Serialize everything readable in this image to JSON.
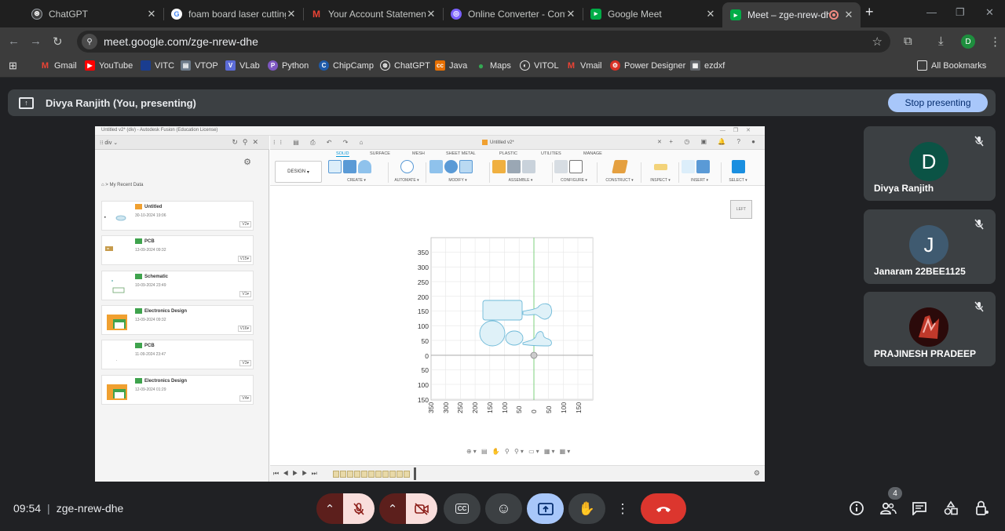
{
  "browser": {
    "tabs": [
      {
        "title": "ChatGPT",
        "favicon": "chatgpt-icon",
        "color": "#e8eaed"
      },
      {
        "title": "foam board laser cutting o",
        "favicon": "google-icon",
        "color": "#4285f4"
      },
      {
        "title": "Your Account Statement fo",
        "favicon": "gmail-icon",
        "color": "#ea4335"
      },
      {
        "title": "Online Converter - Convert",
        "favicon": "converter-icon",
        "color": "#7b61ff"
      },
      {
        "title": "Google Meet",
        "favicon": "meet-icon",
        "color": "#00ac47"
      },
      {
        "title": "Meet – zge-nrew-dhe",
        "favicon": "meet-icon",
        "color": "#00ac47",
        "active": true
      }
    ],
    "new_tab": "+",
    "url": "meet.google.com/zge-nrew-dhe",
    "profile_initial": "D",
    "bookmarks": [
      {
        "label": "Gmail",
        "icon": "gmail-icon",
        "color": "#ea4335"
      },
      {
        "label": "YouTube",
        "icon": "youtube-icon",
        "color": "#ff0000"
      },
      {
        "label": "VITC",
        "icon": "vitc-icon",
        "color": "#1a3d8f"
      },
      {
        "label": "VTOP",
        "icon": "vtop-icon",
        "color": "#6c7a89"
      },
      {
        "label": "VLab",
        "icon": "vlab-icon",
        "color": "#5b6bd6"
      },
      {
        "label": "Python",
        "icon": "python-icon",
        "color": "#7e57c2"
      },
      {
        "label": "ChipCamp",
        "icon": "chipcamp-icon",
        "color": "#1e5aa8"
      },
      {
        "label": "ChatGPT",
        "icon": "chatgpt-icon",
        "color": "#202124"
      },
      {
        "label": "Java",
        "icon": "java-icon",
        "color": "#e76f00"
      },
      {
        "label": "Maps",
        "icon": "maps-icon",
        "color": "#34a853"
      },
      {
        "label": "VITOL",
        "icon": "vitol-icon",
        "color": "#5f6368"
      },
      {
        "label": "Vmail",
        "icon": "vmail-icon",
        "color": "#ea4335"
      },
      {
        "label": "Power Designer",
        "icon": "power-designer-icon",
        "color": "#d93025"
      },
      {
        "label": "ezdxf",
        "icon": "ezdxf-icon",
        "color": "#9aa0a6"
      }
    ],
    "all_bookmarks": "All Bookmarks"
  },
  "meet": {
    "presenter_text": "Divya Ranjith (You, presenting)",
    "stop_presenting": "Stop presenting",
    "participants": [
      {
        "name": "Divya Ranjith",
        "initial": "D",
        "avatar_color": "#0b5345"
      },
      {
        "name": "Janaram 22BEE1125",
        "initial": "J",
        "avatar_color": "#3f5a70"
      },
      {
        "name": "PRAJINESH PRADEEP",
        "initial": "",
        "avatar_color": "#2b0a0a"
      }
    ],
    "time": "09:54",
    "meeting_code": "zge-nrew-dhe",
    "participant_count": "4"
  },
  "fusion": {
    "window_title": "Untitled v2* (div) - Autodesk Fusion (Education License)",
    "team": "div",
    "breadcrumb": "My Recent Data",
    "doc_tab": "Untitled v2*",
    "design_button": "DESIGN",
    "ribbon_tabs": [
      "SOLID",
      "SURFACE",
      "MESH",
      "SHEET METAL",
      "PLASTIC",
      "UTILITIES",
      "MANAGE"
    ],
    "ribbon_groups": [
      "CREATE",
      "AUTOMATE",
      "MODIFY",
      "ASSEMBLE",
      "CONFIGURE",
      "CONSTRUCT",
      "INSPECT",
      "INSERT",
      "SELECT"
    ],
    "viewcube_label": "LEFT",
    "recent_files": [
      {
        "name": "Untitled",
        "date": "30-10-2024 19:06",
        "version": "V2"
      },
      {
        "name": "PCB",
        "date": "13-09-2024 09:32",
        "version": "V15"
      },
      {
        "name": "Schematic",
        "date": "10-09-2024 23:49",
        "version": "V1"
      },
      {
        "name": "Electronics Design",
        "date": "13-09-2024 09:32",
        "version": "V16"
      },
      {
        "name": "PCB",
        "date": "11-09-2024 23:47",
        "version": "V3"
      },
      {
        "name": "Electronics Design",
        "date": "12-09-2024 01:29",
        "version": "V4"
      }
    ],
    "y_ticks": [
      "350",
      "300",
      "250",
      "200",
      "150",
      "100",
      "50",
      "0",
      "50",
      "100",
      "150"
    ],
    "x_ticks": [
      "350",
      "300",
      "250",
      "200",
      "150",
      "100",
      "50",
      "0",
      "50",
      "100",
      "150"
    ]
  }
}
